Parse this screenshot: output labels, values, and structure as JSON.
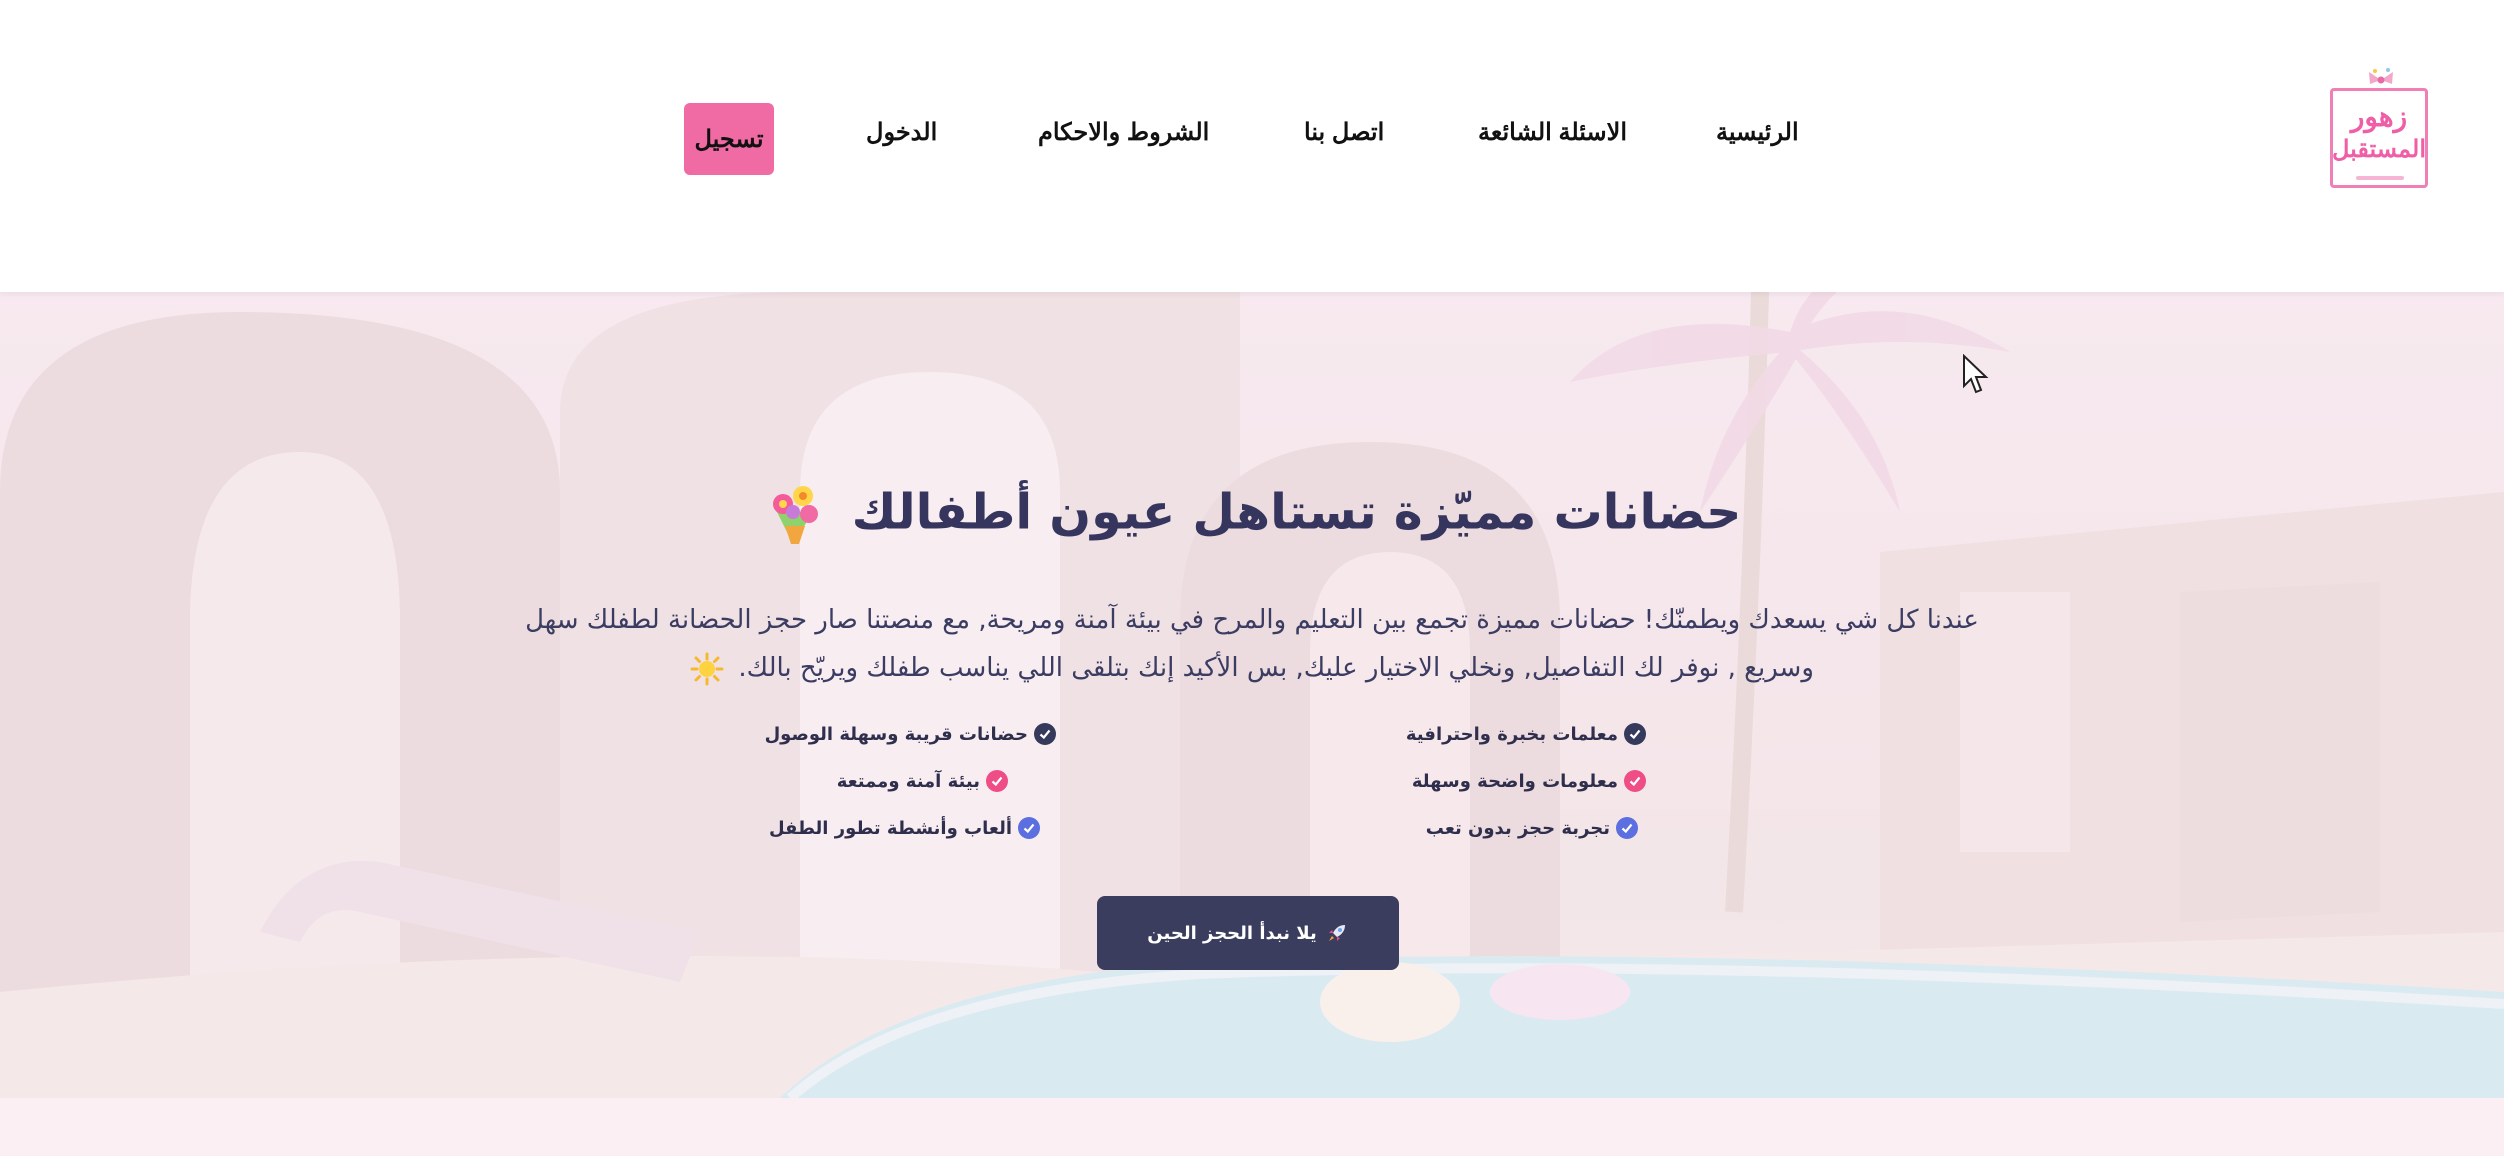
{
  "colors": {
    "brand_pink": "#f06aa4",
    "dark_navy": "#3a3d5e",
    "title_color": "#35355e",
    "check_navy": "#353a5c",
    "check_pink": "#ee4d86",
    "check_blue": "#5b6fe0"
  },
  "logo": {
    "line1": "زهور",
    "line2": "المستقبل"
  },
  "nav": {
    "home": "الرئيسية",
    "faq": "الاسئلة الشائعة",
    "contact": "اتصل بنا",
    "terms": "الشروط والاحكام",
    "login": "الدخول",
    "register": "تسجيل"
  },
  "hero": {
    "title": "حضانات مميّزة تستاهل عيون أطفالك",
    "title_icon": "bouquet-icon",
    "paragraph_line1": "عندنا كل شي يسعدك ويطمنّك! حضانات مميزة تجمع بين التعليم والمرح في بيئة آمنة ومريحة, مع منصتنا صار حجز الحضانة لطفلك سهل",
    "paragraph_line2": "وسريع , نوفر لك التفاصيل, ونخلي الاختيار عليك, بس الأكيد إنك بتلقى اللي يناسب طفلك ويريّح بالك.",
    "paragraph_icon": "sun-icon",
    "features": {
      "f1": "معلمات بخبرة واحترافية",
      "f2": "حضانات قريبة وسهلة الوصول",
      "f3": "معلومات واضحة وسهلة",
      "f4": "بيئة آمنة وممتعة",
      "f5": "تجربة حجز بدون تعب",
      "f6": "ألعاب وأنشطة تطور الطفل"
    },
    "cta_label": "يلا نبدأ الحجز الحين",
    "cta_icon": "rocket-icon"
  }
}
